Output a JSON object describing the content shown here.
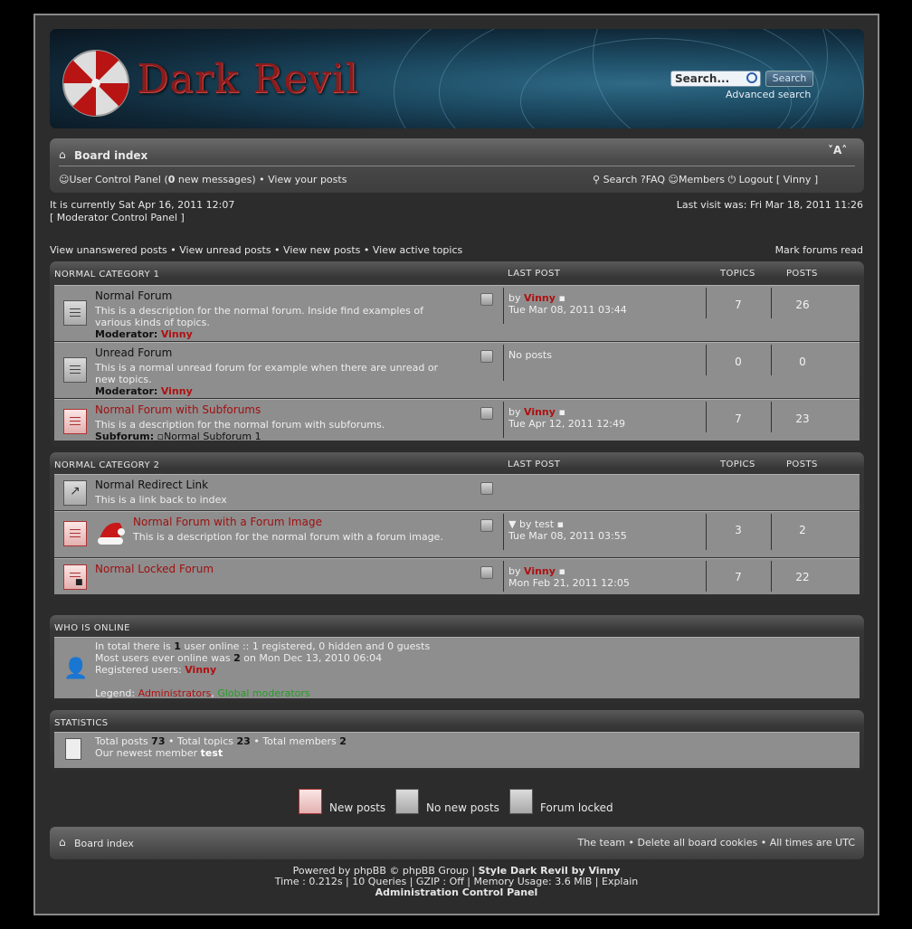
{
  "header": {
    "site_title": "Dark Revil",
    "search_placeholder": "Search...",
    "search_button": "Search",
    "advanced_search": "Advanced search"
  },
  "navbar": {
    "board_index": "Board index",
    "font_toggle": "˅A˄",
    "ucp": "User Control Panel (",
    "new_messages_count": "0",
    "new_messages_suffix": " new messages)",
    "view_posts": "View your posts",
    "search": "Search",
    "faq": "FAQ",
    "members": "Members",
    "logout_prefix": "Logout [",
    "logout_user": "Vinny",
    "logout_suffix": "]"
  },
  "status": {
    "current_time": "It is currently Sat Apr 16, 2011 12:07",
    "mcp": "[ Moderator Control Panel ]",
    "last_visit": "Last visit was: Fri Mar 18, 2011 11:26"
  },
  "quicklinks": {
    "unanswered": "View unanswered posts",
    "unread": "View unread posts",
    "new": "View new posts",
    "active": "View active topics",
    "mark_read": "Mark forums read"
  },
  "columns": {
    "last_post": "LAST POST",
    "topics": "TOPICS",
    "posts": "POSTS"
  },
  "categories": [
    {
      "name": "NORMAL CATEGORY 1",
      "forums": [
        {
          "title": "Normal Forum",
          "desc1": "This is a description for the normal forum. Inside find examples of",
          "desc2": "various kinds of topics.",
          "mod_label": "Moderator:",
          "mod_name": "Vinny",
          "by": "by",
          "author": "Vinny",
          "date": "Tue Mar 08, 2011 03:44",
          "topics": "7",
          "posts": "26"
        },
        {
          "title": "Unread Forum",
          "desc1": "This is a normal unread forum for example when there are unread or",
          "desc2": "new topics.",
          "mod_label": "Moderator:",
          "mod_name": "Vinny",
          "no_posts": "No posts",
          "topics": "0",
          "posts": "0"
        },
        {
          "title": "Normal Forum with Subforums",
          "desc1": "This is a description for the normal forum with subforums.",
          "sub_label": "Subforum:",
          "sub_name": "Normal Subforum 1",
          "by": "by",
          "author": "Vinny",
          "date": "Tue Apr 12, 2011 12:49",
          "topics": "7",
          "posts": "23"
        }
      ]
    },
    {
      "name": "NORMAL CATEGORY 2",
      "forums": [
        {
          "title": "Normal Redirect Link",
          "desc1": "This is a link back to index"
        },
        {
          "title": "Normal Forum with a Forum Image",
          "desc1": "This is a description for the normal forum with a forum image.",
          "by": "by",
          "author": "test",
          "date": "Tue Mar 08, 2011 03:55",
          "topics": "3",
          "posts": "2"
        },
        {
          "title": "Normal Locked Forum",
          "by": "by",
          "author": "Vinny",
          "date": "Mon Feb 21, 2011 12:05",
          "topics": "7",
          "posts": "22"
        }
      ]
    }
  ],
  "online": {
    "title": "WHO IS ONLINE",
    "l1a": "In total there is ",
    "l1n": "1",
    "l1b": " user online :: 1 registered, 0 hidden and 0 guests",
    "l2a": "Most users ever online was ",
    "l2n": "2",
    "l2b": " on Mon Dec 13, 2010 06:04",
    "l3": "Registered users: ",
    "l3u": "Vinny",
    "legend": "Legend: ",
    "admins": "Administrators",
    "globalmods": "Global moderators"
  },
  "stats": {
    "title": "STATISTICS",
    "tp": "Total posts ",
    "tp_n": "73",
    "tt": "Total topics ",
    "tt_n": "23",
    "tm": "Total members ",
    "tm_n": "2",
    "newest": "Our newest member ",
    "newest_name": "test"
  },
  "legend_icons": {
    "new": "New posts",
    "nonew": "No new posts",
    "locked": "Forum locked"
  },
  "footer": {
    "board_index": "Board index",
    "team": "The team",
    "cookies": "Delete all board cookies",
    "times": "All times are UTC"
  },
  "credits": {
    "line1a": "Powered by phpBB © phpBB Group | ",
    "line1b": "Style Dark Revil by Vinny",
    "line2": "Time : 0.212s | 10 Queries | GZIP : Off | Memory Usage: 3.6 MiB | Explain",
    "line3": "Administration Control Panel"
  },
  "colors": {
    "accent_red": "#b01010",
    "global_mod_green": "#22a022"
  }
}
